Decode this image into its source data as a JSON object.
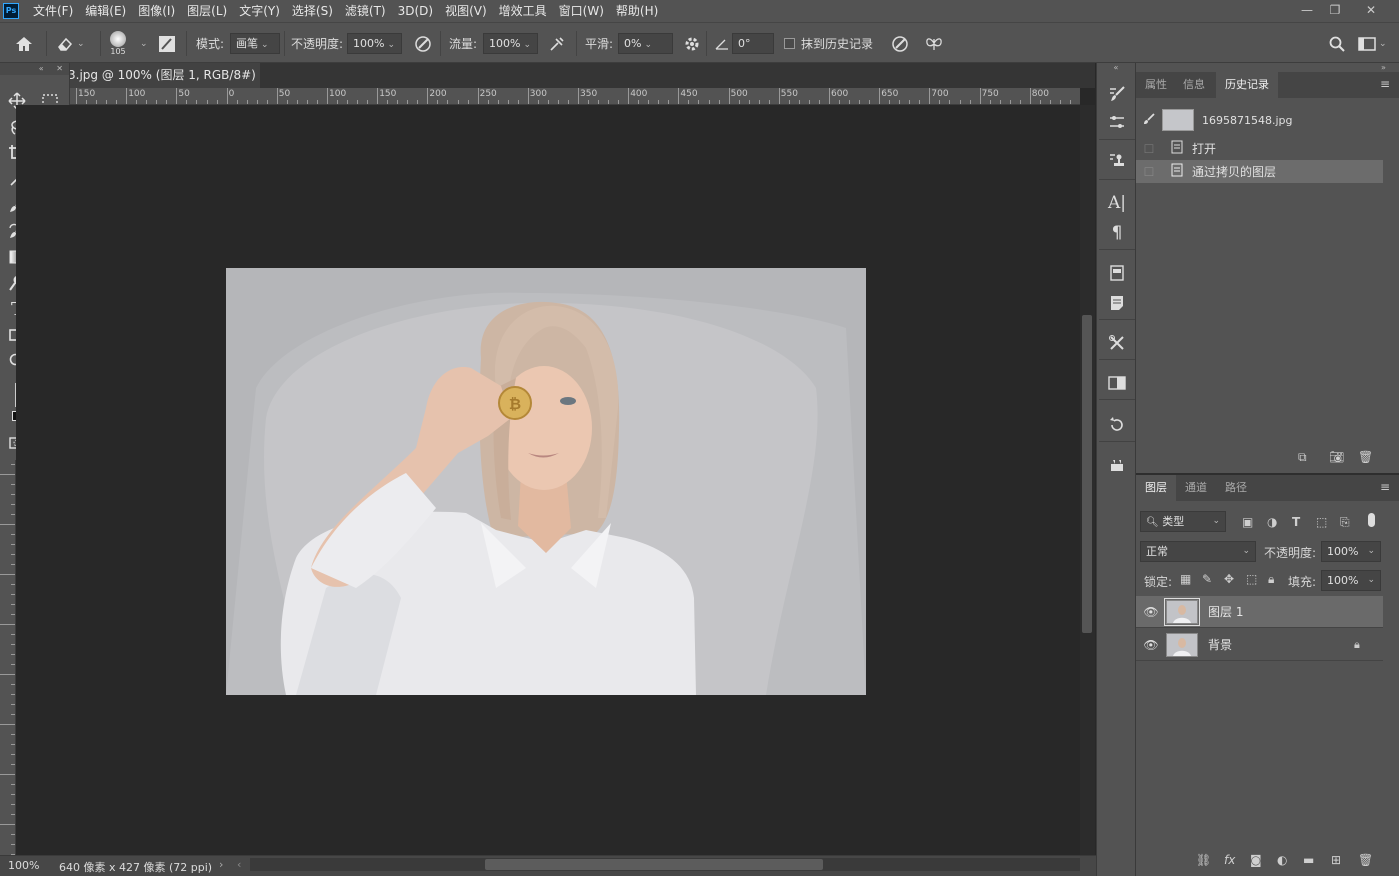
{
  "app": {
    "logo": "Ps",
    "menu": [
      "文件(F)",
      "编辑(E)",
      "图像(I)",
      "图层(L)",
      "文字(Y)",
      "选择(S)",
      "滤镜(T)",
      "3D(D)",
      "视图(V)",
      "增效工具",
      "窗口(W)",
      "帮助(H)"
    ]
  },
  "options": {
    "brush_size": "105",
    "mode_label": "模式:",
    "mode_value": "画笔",
    "opacity_label": "不透明度:",
    "opacity_value": "100%",
    "flow_label": "流量:",
    "flow_value": "100%",
    "smooth_label": "平滑:",
    "smooth_value": "0%",
    "angle_value": "0°",
    "erase_history_label": "抹到历史记录"
  },
  "document": {
    "tab_title": "3.jpg @ 100% (图层 1, RGB/8#) *",
    "ruler_labels": [
      "150",
      "100",
      "50",
      "0",
      "50",
      "100",
      "150",
      "200",
      "250",
      "300",
      "350",
      "400",
      "450",
      "500",
      "550",
      "600",
      "650",
      "700",
      "750",
      "800"
    ]
  },
  "status": {
    "zoom": "100%",
    "doc_info": "640 像素 x 427 像素 (72 ppi)"
  },
  "history_panel": {
    "tabs": [
      "属性",
      "信息",
      "历史记录"
    ],
    "active_tab": "历史记录",
    "snapshot_name": "1695871548.jpg",
    "states": [
      "打开",
      "通过拷贝的图层"
    ]
  },
  "layers_panel": {
    "tabs": [
      "图层",
      "通道",
      "路径"
    ],
    "active_tab": "图层",
    "filter_kind": "类型",
    "blend_mode": "正常",
    "opacity_label": "不透明度:",
    "opacity_value": "100%",
    "lock_label": "锁定:",
    "fill_label": "填充:",
    "fill_value": "100%",
    "layers": [
      {
        "name": "图层 1",
        "selected": true,
        "locked": false
      },
      {
        "name": "背景",
        "selected": false,
        "locked": true
      }
    ]
  },
  "colors": {
    "foreground": "#111111",
    "background": "#3a7db4",
    "accent": "#31a8ff"
  }
}
